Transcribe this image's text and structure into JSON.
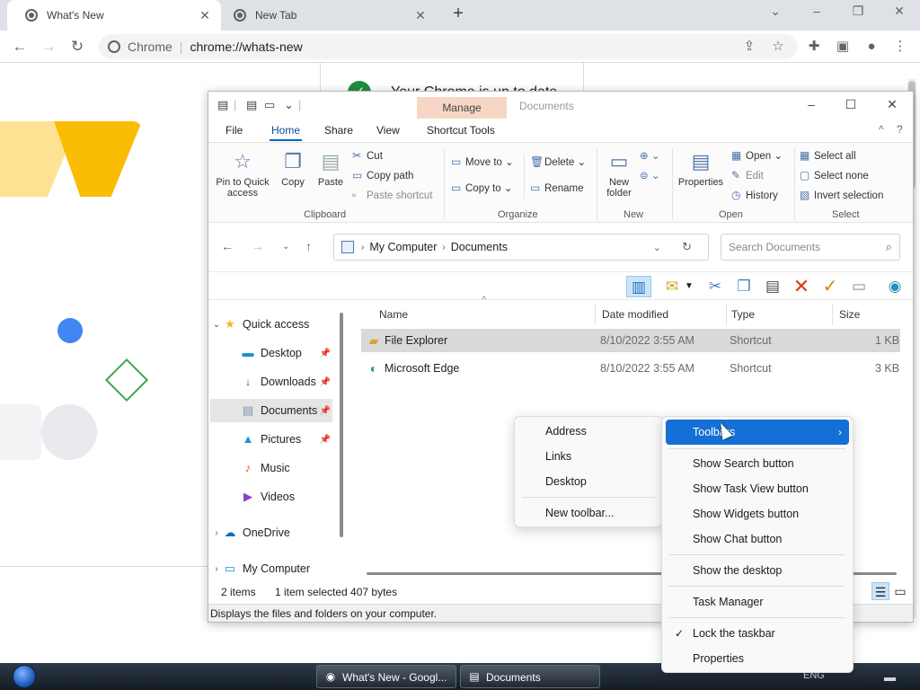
{
  "browser": {
    "tabs": [
      {
        "title": "What's New",
        "close": "✕"
      },
      {
        "title": "New Tab",
        "close": "✕"
      }
    ],
    "new_tab": "+",
    "window_controls": {
      "minimize_tabs": "⌄",
      "minimize": "–",
      "restore": "❐",
      "close": "✕"
    },
    "omnibox": {
      "site": "Chrome",
      "separator": "|",
      "url": "chrome://whats-new"
    },
    "page_title": "Your Chrome is up to date"
  },
  "explorer": {
    "quick_access": {
      "props": "▤",
      "newfolder": "▭",
      "dropdown": "⌄",
      "divider": "|"
    },
    "manage_tab": "Manage",
    "window_title": "Documents",
    "ribbon_tabs": [
      "File",
      "Home",
      "Share",
      "View",
      "Shortcut Tools"
    ],
    "ribbon": {
      "clipboard": {
        "label": "Clipboard",
        "pin": "Pin to Quick access",
        "copy": "Copy",
        "paste": "Paste",
        "cut": "Cut",
        "copy_path": "Copy path",
        "paste_shortcut": "Paste shortcut"
      },
      "organize": {
        "label": "Organize",
        "move_to": "Move to",
        "copy_to": "Copy to",
        "delete": "Delete",
        "rename": "Rename"
      },
      "new": {
        "label": "New",
        "new_folder": "New folder"
      },
      "open": {
        "label": "Open",
        "properties": "Properties",
        "open": "Open",
        "edit": "Edit",
        "history": "History"
      },
      "select": {
        "label": "Select",
        "select_all": "Select all",
        "select_none": "Select none",
        "invert": "Invert selection"
      }
    },
    "address": {
      "root": "My Computer",
      "current": "Documents",
      "search_placeholder": "Search Documents"
    },
    "nav": [
      {
        "label": "Quick access",
        "pinned": false
      },
      {
        "label": "Desktop",
        "pinned": true
      },
      {
        "label": "Downloads",
        "pinned": true
      },
      {
        "label": "Documents",
        "pinned": true
      },
      {
        "label": "Pictures",
        "pinned": true
      },
      {
        "label": "Music",
        "pinned": false
      },
      {
        "label": "Videos",
        "pinned": false
      },
      {
        "label": "OneDrive",
        "pinned": false
      },
      {
        "label": "My Computer",
        "pinned": false
      }
    ],
    "columns": [
      "Name",
      "Date modified",
      "Type",
      "Size"
    ],
    "files": [
      {
        "name": "File Explorer",
        "date": "8/10/2022 3:55 AM",
        "type": "Shortcut",
        "size": "1 KB"
      },
      {
        "name": "Microsoft Edge",
        "date": "8/10/2022 3:55 AM",
        "type": "Shortcut",
        "size": "3 KB"
      }
    ],
    "status": {
      "items": "2 items",
      "selected": "1 item selected  407 bytes"
    },
    "hint": "Displays the files and folders on your computer."
  },
  "toolbars_menu": {
    "items": [
      "Address",
      "Links",
      "Desktop",
      "New toolbar..."
    ]
  },
  "taskbar_menu": {
    "toolbars": "Toolbars",
    "items": [
      "Show Search button",
      "Show Task View button",
      "Show Widgets button",
      "Show Chat button",
      "Show the desktop",
      "Task Manager",
      "Lock the taskbar",
      "Properties"
    ]
  },
  "taskbar": {
    "buttons": [
      "What's New - Googl...",
      "Documents"
    ],
    "tray": "ENG"
  },
  "colors": {
    "accent": "#1470d6",
    "manage_tab": "#f8d6c6",
    "chrome_check": "#1e8e3e"
  }
}
